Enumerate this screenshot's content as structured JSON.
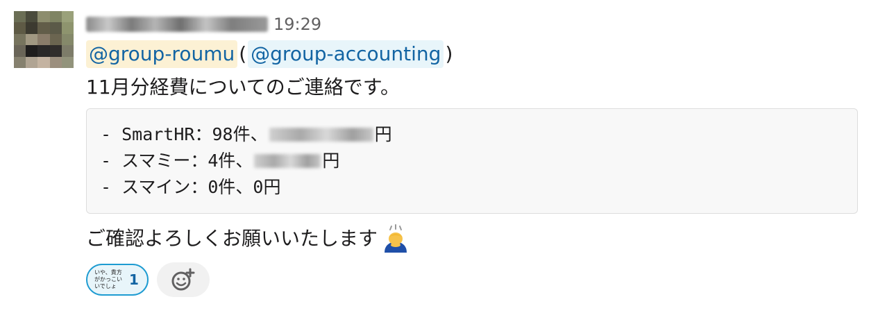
{
  "message": {
    "timestamp": "19:29",
    "mentions": {
      "primary": "@group-roumu",
      "open_paren": "(",
      "secondary": "@group-accounting",
      "close_paren": ")"
    },
    "intro": "11月分経費についてのご連絡です。",
    "code_lines": [
      {
        "prefix": "- SmartHR：98件、",
        "suffix": "円"
      },
      {
        "prefix": "- スマミー：4件、",
        "suffix": "円"
      },
      {
        "prefix": "- スマイン：0件、0円",
        "suffix": ""
      }
    ],
    "closing": "ご確認よろしくお願いいたします",
    "closing_emoji": "bowing-person-icon"
  },
  "reactions": [
    {
      "emoji_text": "いや、貴方がかっこいいでしょ",
      "count": "1"
    }
  ],
  "add_reaction": {
    "icon": "add-emoji-icon"
  },
  "colors": {
    "mention_text": "#1264a3",
    "mention_primary_bg": "#fcf1d4",
    "mention_secondary_bg": "#e8f5fa",
    "reaction_border": "#1d9bd1"
  }
}
